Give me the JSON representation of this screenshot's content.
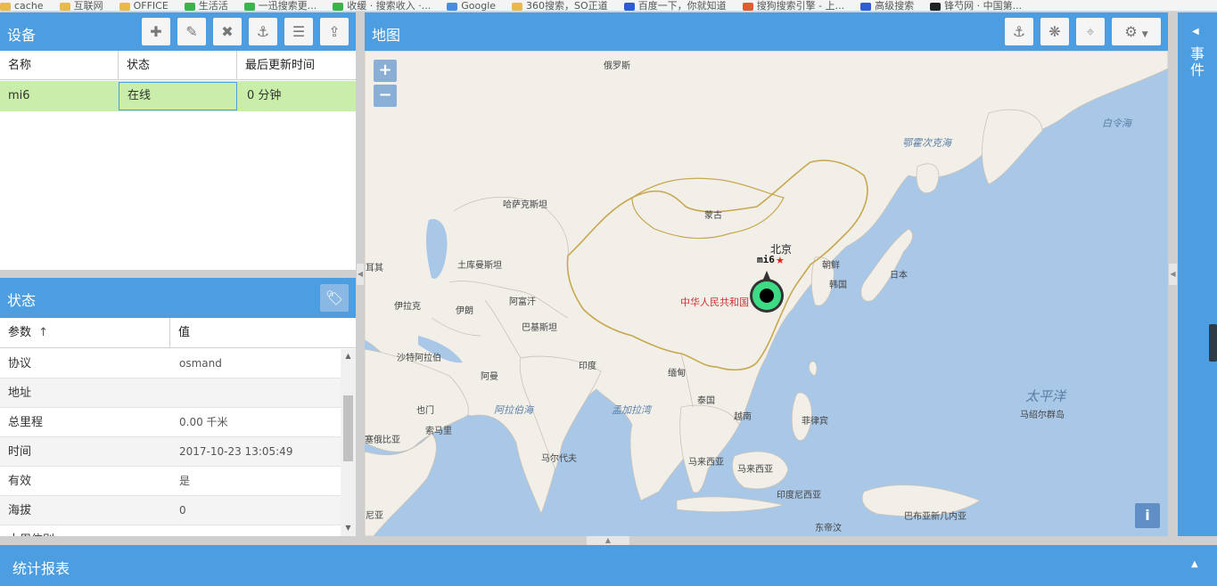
{
  "bookmarks": [
    {
      "label": "cache",
      "color": "#e9b94a"
    },
    {
      "label": "互联网",
      "color": "#e9b94a"
    },
    {
      "label": "OFFICE",
      "color": "#e9b94a"
    },
    {
      "label": "生活活",
      "color": "#3bb54a"
    },
    {
      "label": "一迅搜索更...",
      "color": "#3bb54a"
    },
    {
      "label": "收缓 · 搜索收入 ·...",
      "color": "#3bb54a"
    },
    {
      "label": "Google",
      "color": "#4a8de0"
    },
    {
      "label": "360搜索，SO正道",
      "color": "#e9b94a"
    },
    {
      "label": "百度一下，你就知道",
      "color": "#2f5cd6"
    },
    {
      "label": "搜狗搜索引擎 - 上...",
      "color": "#e35c2f"
    },
    {
      "label": "高级搜索",
      "color": "#2f5cd6"
    },
    {
      "label": "锋芍网 · 中国第...",
      "color": "#222222"
    }
  ],
  "devices": {
    "title": "设备",
    "columns": [
      "名称",
      "状态",
      "最后更新时间"
    ],
    "rows": [
      {
        "name": "mi6",
        "status": "在线",
        "last_update": "0 分钟"
      }
    ],
    "toolbar": [
      "plus-icon",
      "pencil-icon",
      "times-icon",
      "link-icon",
      "command-icon",
      "upload-icon"
    ]
  },
  "status": {
    "title": "状态",
    "columns": [
      "参数",
      "值"
    ],
    "sort_indicator": "↑",
    "rows": [
      {
        "key": "协议",
        "value": "osmand"
      },
      {
        "key": "地址",
        "value": ""
      },
      {
        "key": "总里程",
        "value": "0.00 千米"
      },
      {
        "key": "时间",
        "value": "2017-10-23 13:05:49"
      },
      {
        "key": "有效",
        "value": "是"
      },
      {
        "key": "海拔",
        "value": "0"
      },
      {
        "key": "大周信别",
        "value": ""
      }
    ]
  },
  "map": {
    "title": "地图",
    "zoom_in": "+",
    "zoom_out": "−",
    "info": "i",
    "marker_label": "mi6",
    "labels": {
      "russia": "俄罗斯",
      "okhotsk": "鄂霍次克海",
      "bering": "白令海",
      "kazakhstan": "哈萨克斯坦",
      "mongolia": "蒙古",
      "beijing": "北京",
      "china": "中华人民共和国",
      "korea_n": "朝鲜",
      "korea_s": "韩国",
      "japan": "日本",
      "turkey": "耳其",
      "turkmenistan": "土库曼斯坦",
      "iraq": "伊拉克",
      "iran": "伊朗",
      "afghanistan": "阿富汗",
      "pakistan": "巴基斯坦",
      "saudi": "沙特阿拉伯",
      "oman": "阿曼",
      "india": "印度",
      "myanmar": "缅甸",
      "yemen": "也门",
      "arabian_sea": "阿拉伯海",
      "bay_bengal": "孟加拉湾",
      "thailand": "泰国",
      "vietnam": "越南",
      "philippines": "菲律宾",
      "pacific": "太平洋",
      "marshall": "马绍尔群岛",
      "ethiopia": "塞俄比亚",
      "somalia": "索马里",
      "maldives": "马尔代夫",
      "malaysia1": "马来西亚",
      "malaysia2": "马来西亚",
      "indonesia": "印度尼西亚",
      "png": "巴布亚新几内亚",
      "kenya": "尼亚",
      "timor": "东帝汶"
    }
  },
  "events": {
    "title": "事件"
  },
  "reports": {
    "title": "统计报表"
  },
  "colors": {
    "accent": "#4d9ee0",
    "online_row": "#c8eeaa",
    "sea": "#a9c7e6",
    "land": "#f2efe9",
    "china_border": "#c7a84e",
    "marker": "#3ddc84"
  }
}
